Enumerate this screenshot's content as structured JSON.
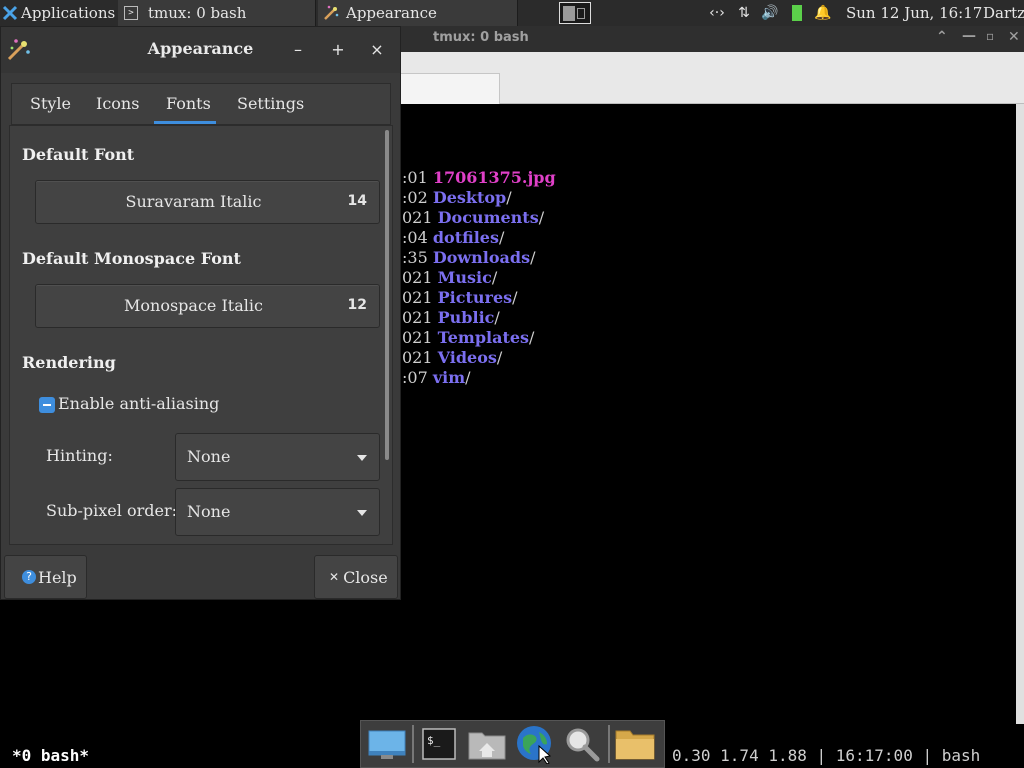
{
  "top_panel": {
    "applications_label": "Applications",
    "tasks": [
      {
        "label": "tmux: 0 bash"
      },
      {
        "label": "Appearance"
      }
    ],
    "clock": "Sun 12 Jun, 16:17",
    "user": "Dartz"
  },
  "terminal": {
    "window_title": "tmux: 0 bash",
    "listing": [
      {
        "time": ":01",
        "name": "17061375.jpg",
        "kind": "file",
        "suffix": ""
      },
      {
        "time": ":02",
        "name": "Desktop",
        "kind": "dir",
        "suffix": "/"
      },
      {
        "time": "021",
        "name": "Documents",
        "kind": "dir",
        "suffix": "/"
      },
      {
        "time": ":04",
        "name": "dotfiles",
        "kind": "dir",
        "suffix": "/"
      },
      {
        "time": ":35",
        "name": "Downloads",
        "kind": "dir",
        "suffix": "/"
      },
      {
        "time": "021",
        "name": "Music",
        "kind": "dir",
        "suffix": "/"
      },
      {
        "time": "021",
        "name": "Pictures",
        "kind": "dir",
        "suffix": "/"
      },
      {
        "time": "021",
        "name": "Public",
        "kind": "dir",
        "suffix": "/"
      },
      {
        "time": "021",
        "name": "Templates",
        "kind": "dir",
        "suffix": "/"
      },
      {
        "time": "021",
        "name": "Videos",
        "kind": "dir",
        "suffix": "/"
      },
      {
        "time": ":07",
        "name": "vim",
        "kind": "dir",
        "suffix": "/"
      }
    ],
    "status_left": "*0 bash*",
    "status_right": "0.30 1.74 1.88 | 16:17:00 | bash"
  },
  "dock": {
    "items": [
      "desktop-icon",
      "terminal-icon",
      "home-folder-icon",
      "web-browser-icon",
      "search-icon",
      "files-icon"
    ]
  },
  "dialog": {
    "title": "Appearance",
    "tabs": [
      "Style",
      "Icons",
      "Fonts",
      "Settings"
    ],
    "active_tab": "Fonts",
    "default_font": {
      "heading": "Default Font",
      "name": "Suravaram Italic",
      "size": "14"
    },
    "mono_font": {
      "heading": "Default Monospace Font",
      "name": "Monospace Italic",
      "size": "12"
    },
    "rendering": {
      "heading": "Rendering",
      "antialias_label": "Enable anti-aliasing",
      "hinting_label": "Hinting:",
      "hinting_value": "None",
      "subpixel_label": "Sub-pixel order:",
      "subpixel_value": "None"
    },
    "help_label": "Help",
    "close_label": "Close"
  },
  "colors": {
    "accent": "#3e8ede",
    "dir_color": "#7b6ff0",
    "file_color": "#e040c8"
  }
}
